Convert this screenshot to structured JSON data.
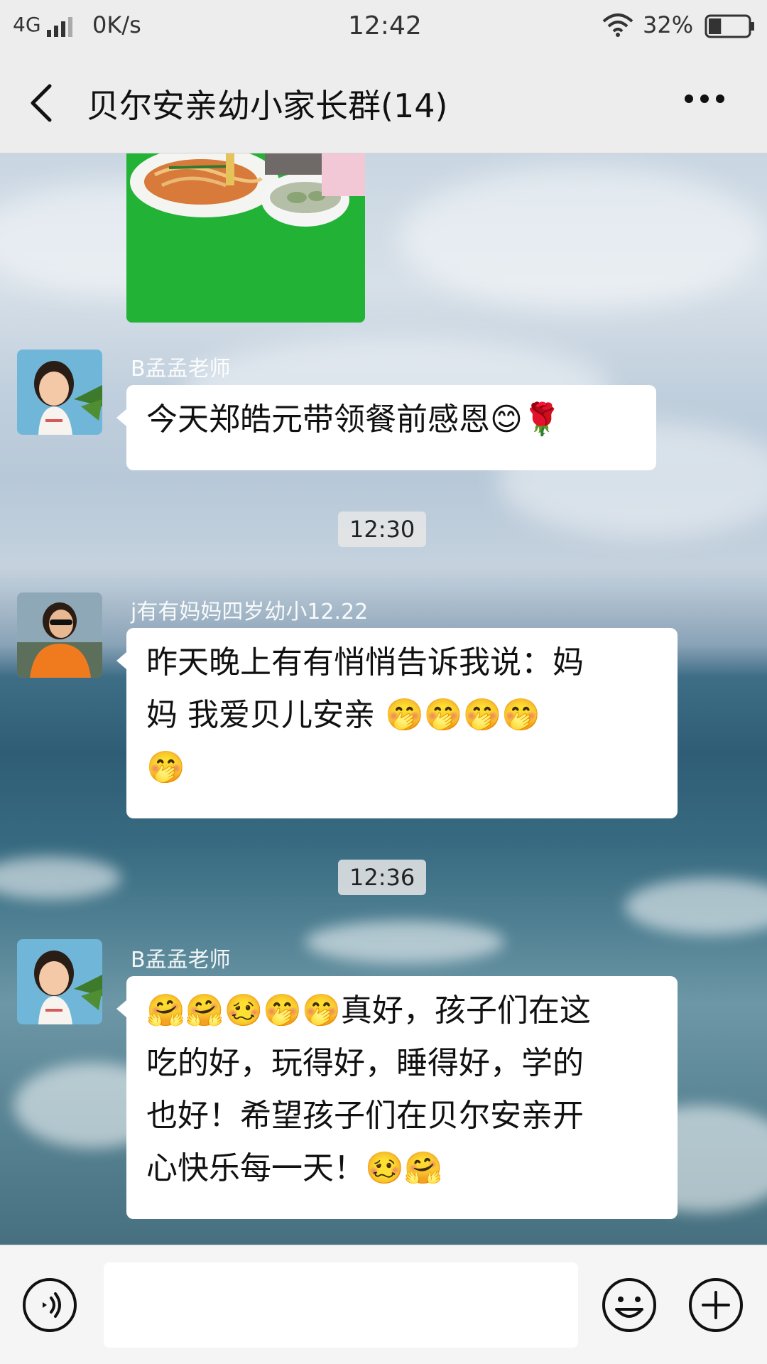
{
  "status_bar": {
    "network": "4G",
    "speed": "0K/s",
    "time": "12:42",
    "battery_percent": "32%",
    "battery_level": 0.32
  },
  "header": {
    "title": "贝尔安亲幼小家长群(14)"
  },
  "messages": [
    {
      "sender": "B孟孟老师",
      "lines": [
        "今天郑皓元带领餐前感恩😊🌹"
      ]
    },
    {
      "timestamp": "12:30"
    },
    {
      "sender": "j有有妈妈四岁幼小12.22",
      "lines": [
        "昨天晚上有有悄悄告诉我说：妈",
        "妈  我爱贝儿安亲   🤭🤭🤭🤭",
        "🤭"
      ]
    },
    {
      "timestamp": "12:36"
    },
    {
      "sender": "B孟孟老师",
      "lines": [
        "🤗🤗🥴🤭🤭真好，孩子们在这",
        "吃的好，玩得好，睡得好，学的",
        "也好！希望孩子们在贝尔安亲开",
        "心快乐每一天！🥴🤗"
      ]
    }
  ],
  "input": {
    "value": "",
    "placeholder": ""
  },
  "icons": {
    "back": "back-arrow-icon",
    "more": "more-icon",
    "voice": "voice-icon",
    "emoji": "emoji-icon",
    "plus": "plus-icon"
  }
}
